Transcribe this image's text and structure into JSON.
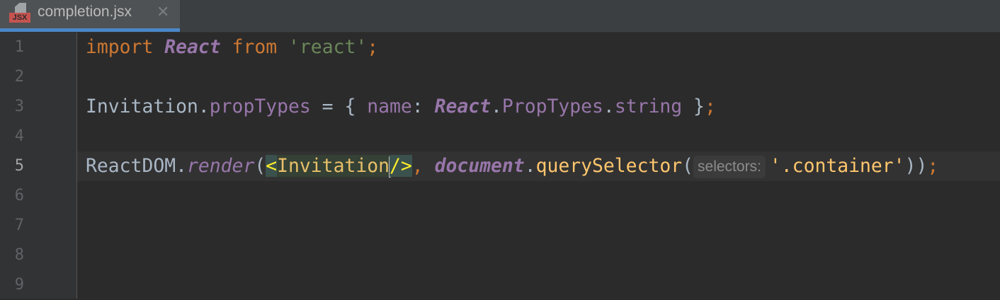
{
  "tab": {
    "title": "completion.jsx",
    "badge": "JSX",
    "icon": "jsx-file-icon",
    "close": "✕"
  },
  "line_numbers": [
    "1",
    "2",
    "3",
    "4",
    "5",
    "6",
    "7",
    "8",
    "9"
  ],
  "current_line": 5,
  "code": {
    "l1": {
      "import": "import",
      "React": "React",
      "from": "from",
      "str": "'react'",
      "semi": ";"
    },
    "l3": {
      "obj": "Invitation",
      "dot": ".",
      "prop": "propTypes",
      "eq": " = { ",
      "name": "name",
      "colon": ": ",
      "React": "React",
      "dot2": ".",
      "pt": "PropTypes",
      "dot3": ".",
      "string": "string",
      "close": " }",
      "semi": ";"
    },
    "l5": {
      "obj": "ReactDOM",
      "dot": ".",
      "render": "render",
      "paren": "(",
      "lt": "<",
      "tag": "Invitation",
      "slash": "/>",
      "comma": ", ",
      "document": "document",
      "dot2": ".",
      "qs": "querySelector",
      "paren2": "(",
      "hint": "selectors:",
      "str": "'.container'",
      "close": "))",
      "semi": ";"
    }
  },
  "colors": {
    "keyword": "#cc7832",
    "string": "#6a8759",
    "field": "#9876aa",
    "function": "#ffc66d",
    "accent": "#4a88c7"
  }
}
